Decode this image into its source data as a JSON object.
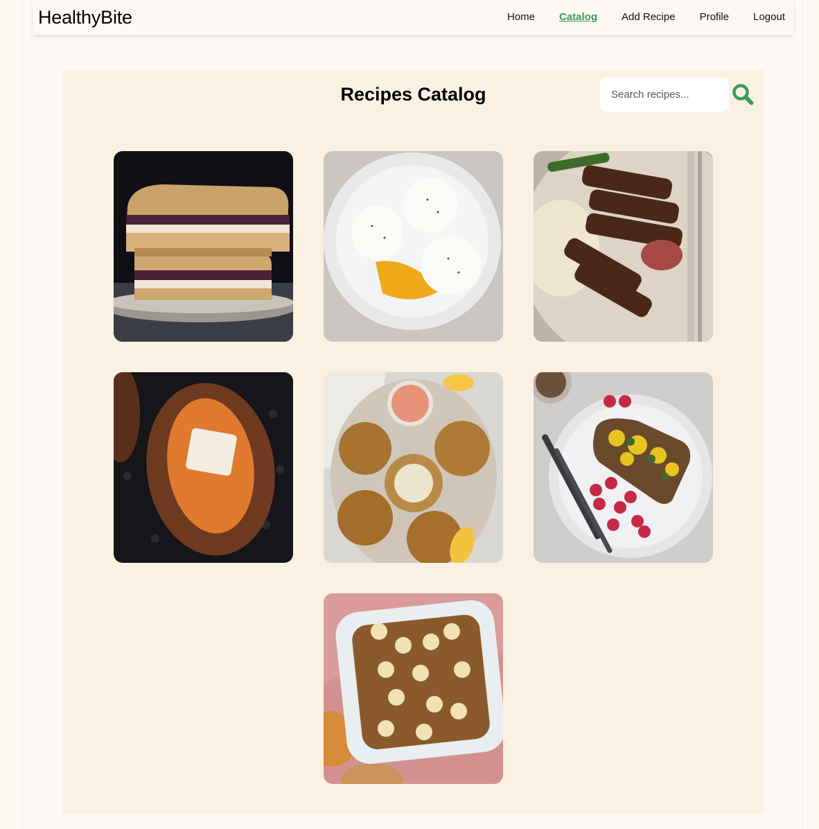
{
  "brand": "HealthyBite",
  "nav": {
    "home": "Home",
    "catalog": "Catalog",
    "add_recipe": "Add Recipe",
    "profile": "Profile",
    "logout": "Logout"
  },
  "catalog": {
    "title": "Recipes Catalog",
    "search_placeholder": "Search recipes...",
    "search_icon": "search-icon"
  },
  "colors": {
    "accent": "#3b9a5a",
    "catalog_bg": "#faf1e2",
    "page_bg": "#fdf8f3"
  },
  "recipes": [
    {
      "image": "grilled-sandwich-photo"
    },
    {
      "image": "poached-eggs-photo"
    },
    {
      "image": "sliced-steak-mashed-potatoes-photo"
    },
    {
      "image": "baked-sweet-potato-photo"
    },
    {
      "image": "crab-cakes-with-sauce-photo"
    },
    {
      "image": "toast-with-eggs-and-raspberries-photo"
    },
    {
      "image": "banana-bake-casserole-photo"
    }
  ]
}
